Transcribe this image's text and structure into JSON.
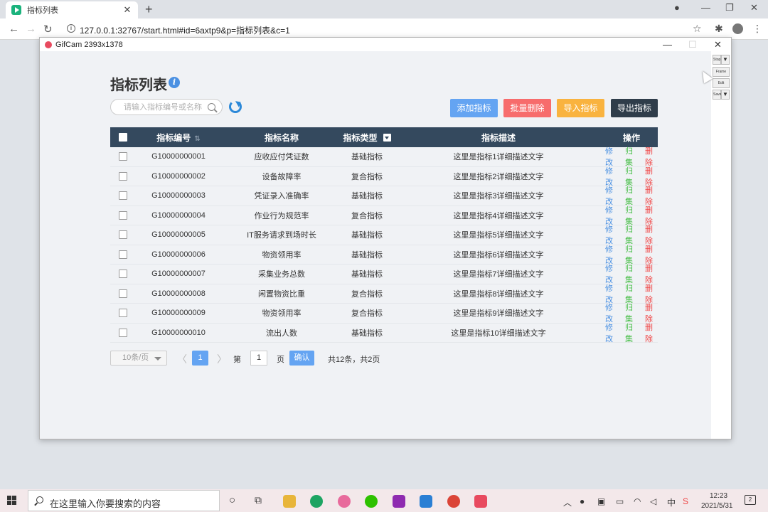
{
  "browser": {
    "tab_title": "指标列表",
    "url": "127.0.0.1:32767/start.html#id=6axtp9&p=指标列表&c=1"
  },
  "gifcam": {
    "title": "GifCam 2393x1378",
    "side_buttons": [
      "Stop",
      "Frame",
      "Edit",
      "Save"
    ]
  },
  "page": {
    "title": "指标列表",
    "search_placeholder": "请输入指标编号或名称",
    "buttons": {
      "add": "添加指标",
      "batch_delete": "批量删除",
      "import": "导入指标",
      "export": "导出指标"
    },
    "columns": {
      "code": "指标编号",
      "name": "指标名称",
      "type": "指标类型",
      "desc": "指标描述",
      "ops": "操作"
    },
    "ops": {
      "edit": "修改",
      "archive": "归集",
      "delete": "删除"
    },
    "rows": [
      {
        "code": "G10000000001",
        "name": "应收应付凭证数",
        "type": "基础指标",
        "desc": "这里是指标1详细描述文字"
      },
      {
        "code": "G10000000002",
        "name": "设备故障率",
        "type": "复合指标",
        "desc": "这里是指标2详细描述文字"
      },
      {
        "code": "G10000000003",
        "name": "凭证录入准确率",
        "type": "基础指标",
        "desc": "这里是指标3详细描述文字"
      },
      {
        "code": "G10000000004",
        "name": "作业行为规范率",
        "type": "复合指标",
        "desc": "这里是指标4详细描述文字"
      },
      {
        "code": "G10000000005",
        "name": "IT服务请求到场时长",
        "type": "基础指标",
        "desc": "这里是指标5详细描述文字"
      },
      {
        "code": "G10000000006",
        "name": "物资领用率",
        "type": "基础指标",
        "desc": "这里是指标6详细描述文字"
      },
      {
        "code": "G10000000007",
        "name": "采集业务总数",
        "type": "基础指标",
        "desc": "这里是指标7详细描述文字"
      },
      {
        "code": "G10000000008",
        "name": "闲置物资比重",
        "type": "复合指标",
        "desc": "这里是指标8详细描述文字"
      },
      {
        "code": "G10000000009",
        "name": "物资领用率",
        "type": "复合指标",
        "desc": "这里是指标9详细描述文字"
      },
      {
        "code": "G10000000010",
        "name": "流出人数",
        "type": "基础指标",
        "desc": "这里是指标10详细描述文字"
      }
    ],
    "pager": {
      "page_size": "10条/页",
      "current_page": "1",
      "goto_prefix": "第",
      "goto_value": "1",
      "goto_suffix": "页",
      "confirm": "确认",
      "summary": "共12条，共2页"
    }
  },
  "taskbar": {
    "search_text": "在这里输入你要搜索的内容",
    "time": "12:23",
    "date": "2021/5/31",
    "ime": "中",
    "notifications": "2"
  }
}
